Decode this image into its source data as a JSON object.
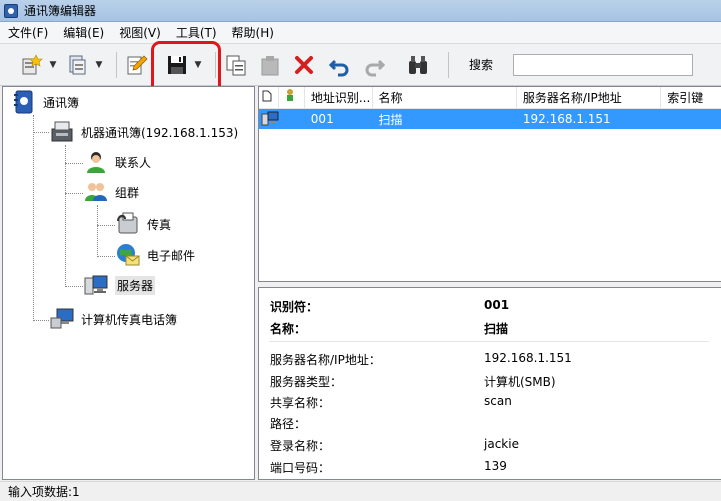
{
  "window": {
    "title": "通讯簿编辑器"
  },
  "menu": [
    "文件(F)",
    "编辑(E)",
    "视图(V)",
    "工具(T)",
    "帮助(H)"
  ],
  "toolbar": {
    "search_label": "搜索",
    "search_value": ""
  },
  "tree": {
    "root": "通讯簿",
    "machine_book": "机器通讯簿(192.168.1.153)",
    "contacts": "联系人",
    "groups": "组群",
    "fax": "传真",
    "email": "电子邮件",
    "server": "服务器",
    "pc_fax_book": "计算机传真电话簿"
  },
  "list": {
    "columns": [
      "",
      "",
      "地址识别...",
      "名称",
      "服务器名称/IP地址",
      "索引键"
    ],
    "rows": [
      {
        "id": "001",
        "name": "扫描",
        "server": "192.168.1.151",
        "index": ""
      }
    ]
  },
  "detail": {
    "id_label": "识别符：",
    "id_value": "001",
    "name_label": "名称：",
    "name_value": "扫描",
    "server_label": "服务器名称/IP地址：",
    "server_value": "192.168.1.151",
    "type_label": "服务器类型：",
    "type_value": "计算机(SMB)",
    "share_label": "共享名称：",
    "share_value": "scan",
    "path_label": "路径：",
    "path_value": "",
    "login_label": "登录名称：",
    "login_value": "jackie",
    "port_label": "端口号码：",
    "port_value": "139"
  },
  "status": {
    "text": "输入项数据:1"
  },
  "colors": {
    "selection": "#3399ff",
    "highlight_border": "#e0161b",
    "delete_icon": "#d61f1f"
  }
}
